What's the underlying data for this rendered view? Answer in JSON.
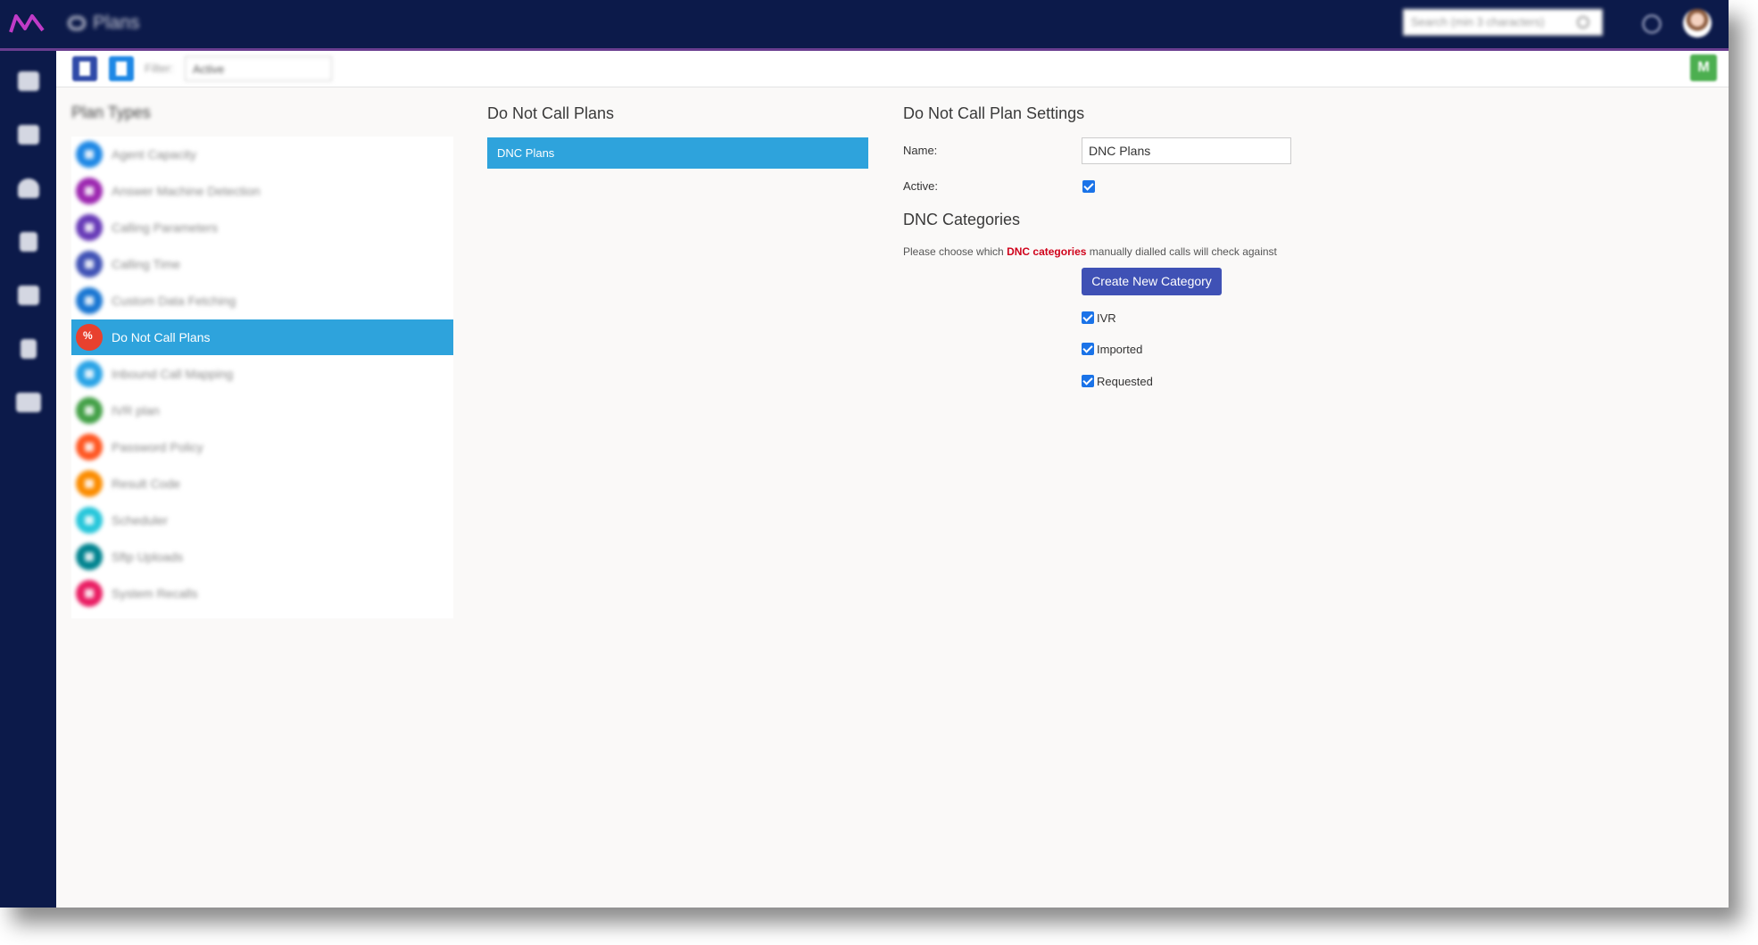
{
  "header": {
    "app_title": "Plans",
    "search_placeholder": "Search (min 3 characters)"
  },
  "toolbar": {
    "filter_label": "Filter:",
    "filter_value": "Active",
    "right_button_label": "M"
  },
  "plan_types": {
    "title": "Plan Types",
    "items": [
      {
        "label": "Agent Capacity",
        "color": "#1e88e5"
      },
      {
        "label": "Answer Machine Detection",
        "color": "#9c27b0"
      },
      {
        "label": "Calling Parameters",
        "color": "#673ab7"
      },
      {
        "label": "Calling Time",
        "color": "#3f51b5"
      },
      {
        "label": "Custom Data Fetching",
        "color": "#1976d2"
      },
      {
        "label": "Do Not Call Plans",
        "color": "#e8412e"
      },
      {
        "label": "Inbound Call Mapping",
        "color": "#29a3e6"
      },
      {
        "label": "IVR plan",
        "color": "#43a047"
      },
      {
        "label": "Password Policy",
        "color": "#ff5722"
      },
      {
        "label": "Result Code",
        "color": "#fb8c00"
      },
      {
        "label": "Scheduler",
        "color": "#26c6da"
      },
      {
        "label": "Sftp Uploads",
        "color": "#00838f"
      },
      {
        "label": "System Recalls",
        "color": "#e91e63"
      }
    ]
  },
  "dnc_plans": {
    "title": "Do Not Call Plans",
    "items": [
      "DNC Plans"
    ]
  },
  "settings": {
    "title": "Do Not Call Plan Settings",
    "name_label": "Name:",
    "name_value": "DNC Plans",
    "active_label": "Active:"
  },
  "categories": {
    "title": "DNC Categories",
    "desc_before": "Please choose which ",
    "desc_highlight": "DNC categories",
    "desc_after": " manually dialled calls will check against",
    "create_button": "Create New Category",
    "items": [
      "IVR",
      "Imported",
      "Requested"
    ]
  }
}
